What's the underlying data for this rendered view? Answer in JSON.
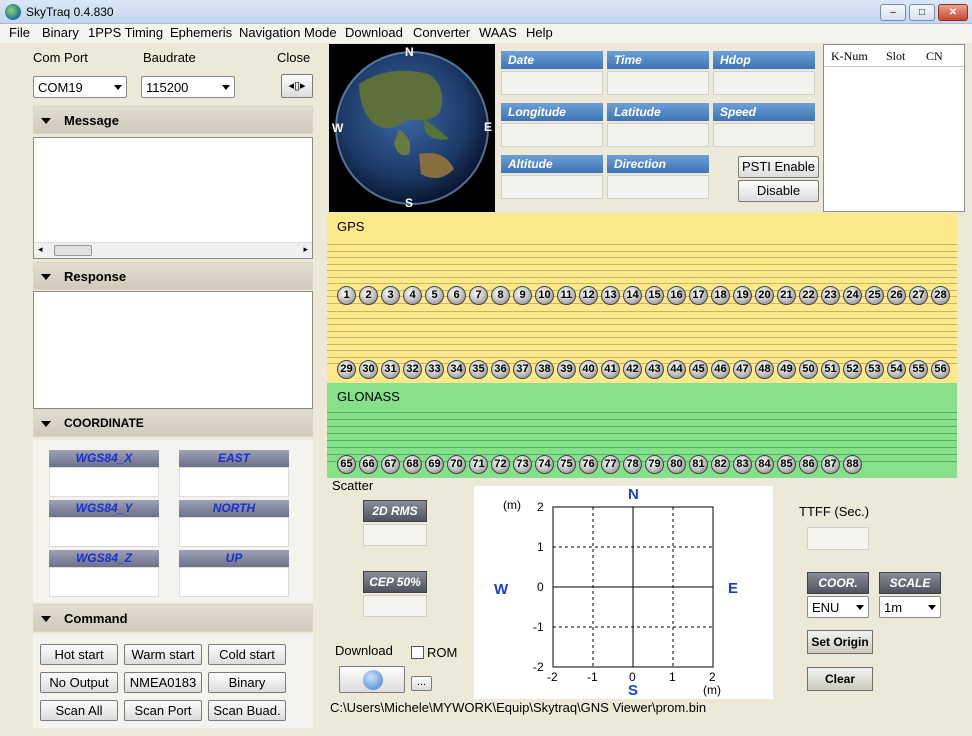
{
  "window": {
    "title": "SkyTraq 0.4.830",
    "min": "‒",
    "max": "□",
    "close": "✕"
  },
  "menu": [
    "File",
    "Binary",
    "1PPS Timing",
    "Ephemeris",
    "Navigation Mode",
    "Download",
    "Converter",
    "WAAS",
    "Help"
  ],
  "conn": {
    "com_port_label": "Com Port",
    "baudrate_label": "Baudrate",
    "close_label": "Close",
    "com_port_value": "COM19",
    "baudrate_value": "115200"
  },
  "sections": {
    "message": "Message",
    "response": "Response",
    "coordinate": "COORDINATE",
    "command": "Command"
  },
  "coordinates": {
    "wgs84_x": "WGS84_X",
    "wgs84_y": "WGS84_Y",
    "wgs84_z": "WGS84_Z",
    "east": "EAST",
    "north": "NORTH",
    "up": "UP"
  },
  "commands": [
    [
      "Hot start",
      "Warm start",
      "Cold start"
    ],
    [
      "No Output",
      "NMEA0183",
      "Binary"
    ],
    [
      "Scan All",
      "Scan Port",
      "Scan Buad."
    ]
  ],
  "globe": {
    "n": "N",
    "s": "S",
    "e": "E",
    "w": "W"
  },
  "info": {
    "date": "Date",
    "time": "Time",
    "hdop": "Hdop",
    "longitude": "Longitude",
    "latitude": "Latitude",
    "speed": "Speed",
    "altitude": "Altitude",
    "direction": "Direction"
  },
  "psti": {
    "enable": "PSTI Enable",
    "disable": "Disable"
  },
  "sat_table": {
    "headers": [
      "K-Num",
      "Slot",
      "CN"
    ]
  },
  "gps": {
    "label": "GPS",
    "row1": [
      1,
      2,
      3,
      4,
      5,
      6,
      7,
      8,
      9,
      10,
      11,
      12,
      13,
      14,
      15,
      16,
      17,
      18,
      19,
      20,
      21,
      22,
      23,
      24,
      25,
      26,
      27,
      28
    ],
    "row2": [
      29,
      30,
      31,
      32,
      33,
      34,
      35,
      36,
      37,
      38,
      39,
      40,
      41,
      42,
      43,
      44,
      45,
      46,
      47,
      48,
      49,
      50,
      51,
      52,
      53,
      54,
      55,
      56
    ]
  },
  "glonass": {
    "label": "GLONASS",
    "row": [
      65,
      66,
      67,
      68,
      69,
      70,
      71,
      72,
      73,
      74,
      75,
      76,
      77,
      78,
      79,
      80,
      81,
      82,
      83,
      84,
      85,
      86,
      87,
      88
    ]
  },
  "scatter": {
    "label": "Scatter",
    "rms_label": "2D RMS",
    "cep_label": "CEP 50%",
    "unit_top": "(m)",
    "unit_bottom": "(m)",
    "compass": {
      "n": "N",
      "s": "S",
      "e": "E",
      "w": "W"
    },
    "y_ticks": [
      "2",
      "1",
      "0",
      "-1",
      "-2"
    ],
    "x_ticks": [
      "-2",
      "-1",
      "0",
      "1",
      "2"
    ]
  },
  "download": {
    "label": "Download",
    "rom_label": "ROM",
    "browse": "...",
    "path": "C:\\Users\\Michele\\MYWORK\\Equip\\Skytraq\\GNS Viewer\\prom.bin"
  },
  "ttff": {
    "label": "TTFF (Sec.)"
  },
  "coor": {
    "label": "COOR.",
    "value": "ENU"
  },
  "scale": {
    "label": "SCALE",
    "value": "1m"
  },
  "actions": {
    "set_origin": "Set Origin",
    "clear": "Clear"
  }
}
